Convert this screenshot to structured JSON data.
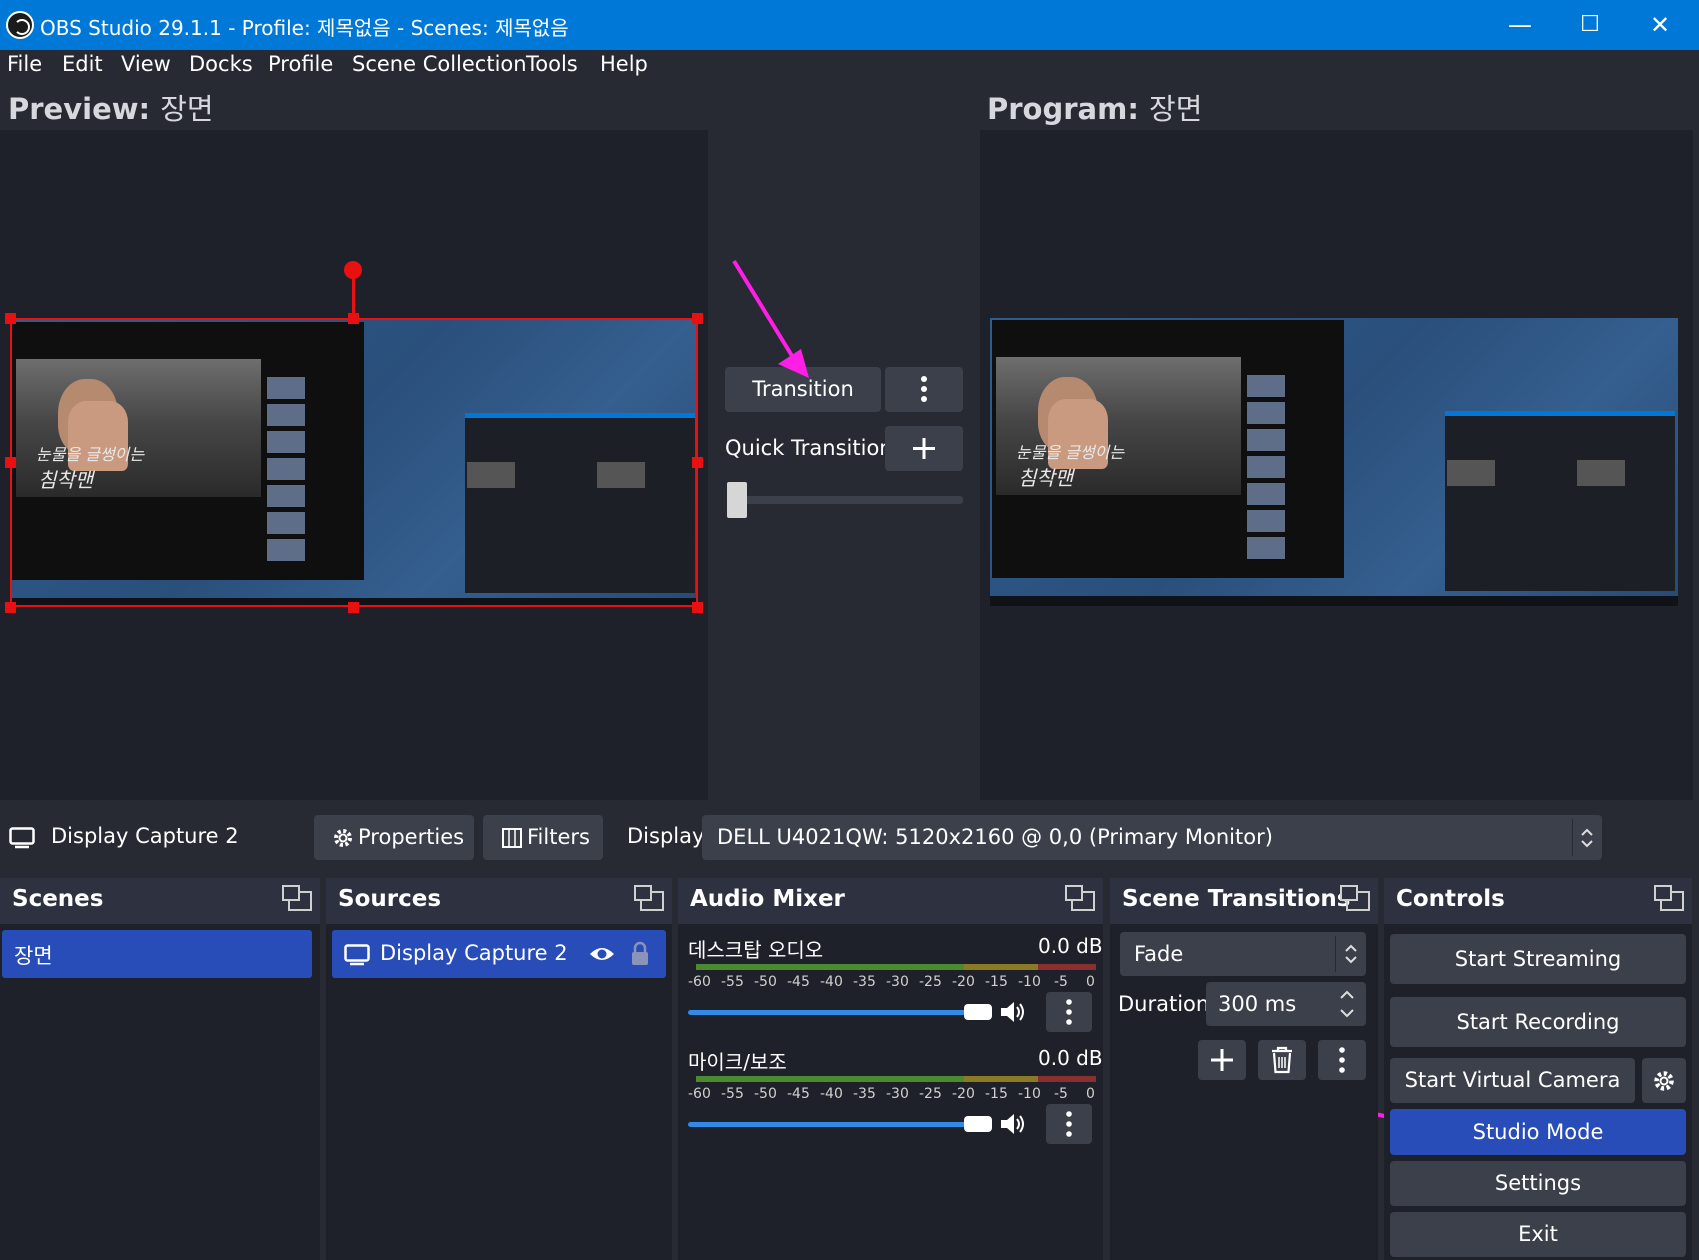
{
  "window": {
    "title": "OBS Studio 29.1.1 - Profile: 제목없음 - Scenes: 제목없음",
    "minimize": "—",
    "maximize": "☐",
    "close": "✕"
  },
  "menu": [
    "File",
    "Edit",
    "View",
    "Docks",
    "Profile",
    "Scene Collection",
    "Tools",
    "Help"
  ],
  "preview": {
    "label": "Preview:",
    "scene": "장면"
  },
  "program": {
    "label": "Program:",
    "scene": "장면"
  },
  "transition_panel": {
    "transition_label": "Transition",
    "quick_transitions_label": "Quick Transitions",
    "tbar_value": 0
  },
  "mock_screen": {
    "subtitle_line1": "눈물을 글썽이는",
    "subtitle_line2": "침착맨"
  },
  "source_toolbar": {
    "source_name": "Display Capture 2",
    "properties_label": "Properties",
    "filters_label": "Filters",
    "display_label": "Display",
    "display_value": "DELL U4021QW: 5120x2160 @ 0,0 (Primary Monitor)"
  },
  "scenes": {
    "title": "Scenes",
    "items": [
      "장면"
    ]
  },
  "sources": {
    "title": "Sources",
    "items": [
      {
        "name": "Display Capture 2",
        "visible": true,
        "locked": false
      }
    ]
  },
  "audio_mixer": {
    "title": "Audio Mixer",
    "ticks": [
      "-60",
      "-55",
      "-50",
      "-45",
      "-40",
      "-35",
      "-30",
      "-25",
      "-20",
      "-15",
      "-10",
      "-5",
      "0"
    ],
    "channels": [
      {
        "name": "데스크탑 오디오",
        "db": "0.0 dB",
        "volume": 1.0
      },
      {
        "name": "마이크/보조",
        "db": "0.0 dB",
        "volume": 1.0
      }
    ]
  },
  "scene_transitions": {
    "title": "Scene Transitions",
    "selected": "Fade",
    "duration_label": "Duration",
    "duration_value": "300 ms"
  },
  "controls": {
    "title": "Controls",
    "start_streaming": "Start Streaming",
    "start_recording": "Start Recording",
    "start_virtual_camera": "Start Virtual Camera",
    "studio_mode": "Studio Mode",
    "settings": "Settings",
    "exit": "Exit"
  },
  "colors": {
    "titlebar": "#0078d7",
    "background": "#272a33",
    "selection": "#284cb8",
    "studio_mode_active": "#284cb8",
    "annotation_arrow": "#ff1ee6",
    "selection_box": "#e81010"
  },
  "icons": {
    "obs_logo": "obs-logo-icon",
    "monitor": "monitor-icon",
    "gear": "gear-icon",
    "filters": "filters-icon",
    "eye": "eye-icon",
    "lock": "lock-icon",
    "speaker": "speaker-icon",
    "kebab": "kebab-menu-icon",
    "plus": "plus-icon",
    "trash": "trash-icon"
  }
}
